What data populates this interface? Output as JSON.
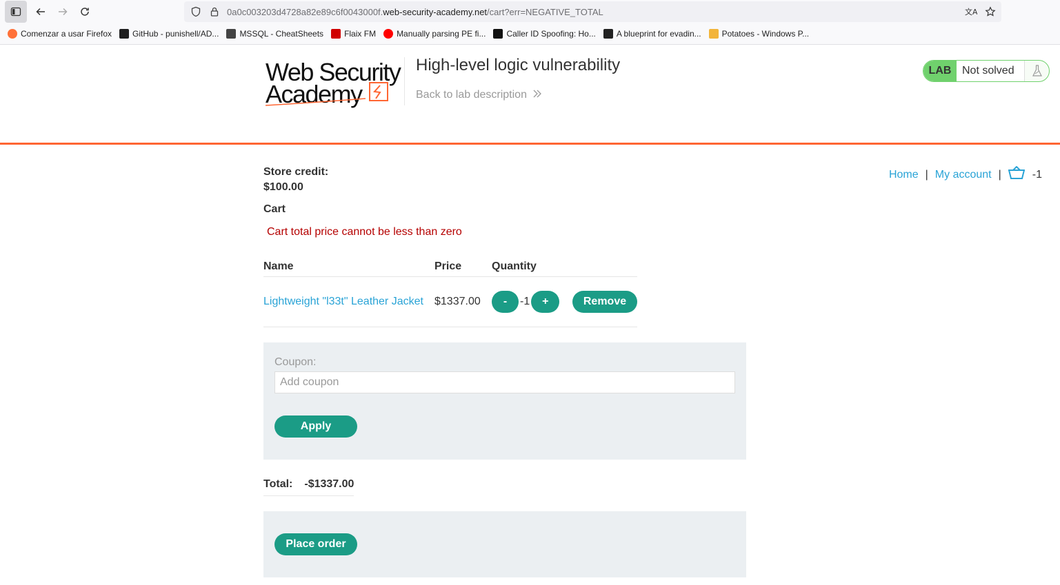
{
  "browser": {
    "url_prefix": "0a0c003203d4728a82e89c6f0043000f.",
    "url_domain": "web-security-academy.net",
    "url_path": "/cart?err=NEGATIVE_TOTAL",
    "bookmarks": [
      {
        "label": "Comenzar a usar Firefox",
        "icon": "firefox-icon",
        "color": "#ff7139"
      },
      {
        "label": "GitHub - punishell/AD...",
        "icon": "github-icon",
        "color": "#1f1f1f"
      },
      {
        "label": "MSSQL - CheatSheets",
        "icon": "runner-icon",
        "color": "#444444"
      },
      {
        "label": "Flaix FM",
        "icon": "flaix-icon",
        "color": "#d00000"
      },
      {
        "label": "Manually parsing PE fi...",
        "icon": "youtube-icon",
        "color": "#ff0000"
      },
      {
        "label": "Caller ID Spoofing: Ho...",
        "icon": "dots-icon",
        "color": "#111111"
      },
      {
        "label": "A blueprint for evadin...",
        "icon": "terminal-icon",
        "color": "#222222"
      },
      {
        "label": "Potatoes - Windows P...",
        "icon": "potato-icon",
        "color": "#f2b53a"
      }
    ]
  },
  "header": {
    "logo_line1": "Web Security",
    "logo_line2": "Academy",
    "lab_title": "High-level logic vulnerability",
    "back_link": "Back to lab description",
    "lab_badge": "LAB",
    "lab_status": "Not solved"
  },
  "nav": {
    "home": "Home",
    "separator": "|",
    "my_account": "My account",
    "cart_count": "-1"
  },
  "main": {
    "store_credit_label": "Store credit:",
    "store_credit_value": "$100.00",
    "cart_heading": "Cart",
    "error_message": "Cart total price cannot be less than zero",
    "table": {
      "headers": [
        "Name",
        "Price",
        "Quantity"
      ],
      "rows": [
        {
          "name": "Lightweight \"l33t\" Leather Jacket",
          "price": "$1337.00",
          "quantity": "-1",
          "minus": "-",
          "plus": "+",
          "remove": "Remove"
        }
      ]
    },
    "coupon": {
      "label": "Coupon:",
      "placeholder": "Add coupon",
      "apply": "Apply"
    },
    "total_label": "Total:",
    "total_value": "-$1337.00",
    "place_order": "Place order"
  },
  "colors": {
    "accent_orange": "#ff6633",
    "button_green": "#1b9c86",
    "link_blue": "#29a3d6",
    "error_red": "#b50000",
    "lab_green": "#70d16d"
  }
}
